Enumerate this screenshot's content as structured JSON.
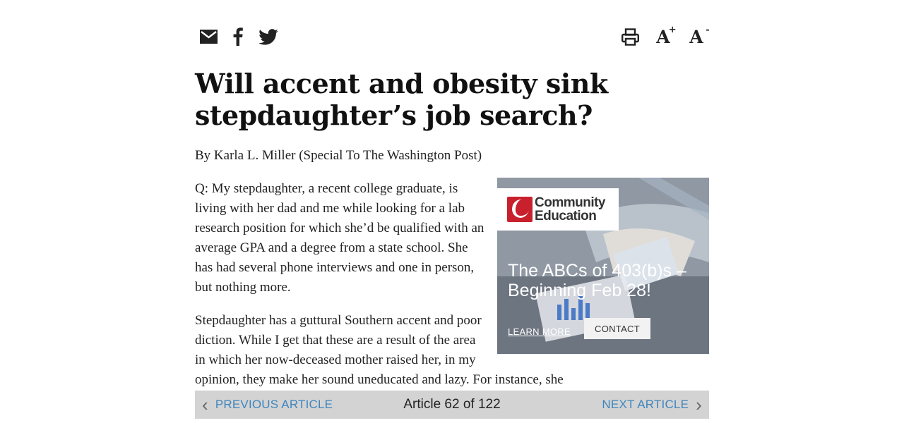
{
  "toolbar": {
    "share_icons": [
      "email-icon",
      "facebook-icon",
      "twitter-icon"
    ],
    "tools": [
      "print-icon",
      "font-increase-icon",
      "font-decrease-icon"
    ],
    "font_increase_label": "A",
    "font_increase_sup": "+",
    "font_decrease_label": "A",
    "font_decrease_sup": "-"
  },
  "article": {
    "headline": "Will accent and obesity sink stepdaughter’s job search?",
    "byline": "By Karla L. Miller (Special To The Washington Post)",
    "paragraphs": [
      "Q: My stepdaughter, a recent college graduate, is living with her dad and me while looking for a lab research position for which she’d be qualified with an average GPA and a degree from a state school. She has had several phone interviews and one in person, but nothing more.",
      "Stepdaughter has a guttural Southern accent and poor diction. While I get that these are a result of the area in which her now-deceased mother raised her, in my opinion, they make her sound uneducated and lazy. For instance, she"
    ]
  },
  "ad": {
    "logo_line1": "Community",
    "logo_line2": "Education",
    "headline": "The ABCs of 403(b)s – Beginning Feb 28!",
    "learn_more": "LEARN MORE",
    "contact": "CONTACT",
    "accent_color": "#c9202d"
  },
  "article_nav": {
    "prev_label": "PREVIOUS ARTICLE",
    "next_label": "NEXT ARTICLE",
    "count_text": "Article 62 of 122",
    "link_color": "#3f86bd"
  }
}
